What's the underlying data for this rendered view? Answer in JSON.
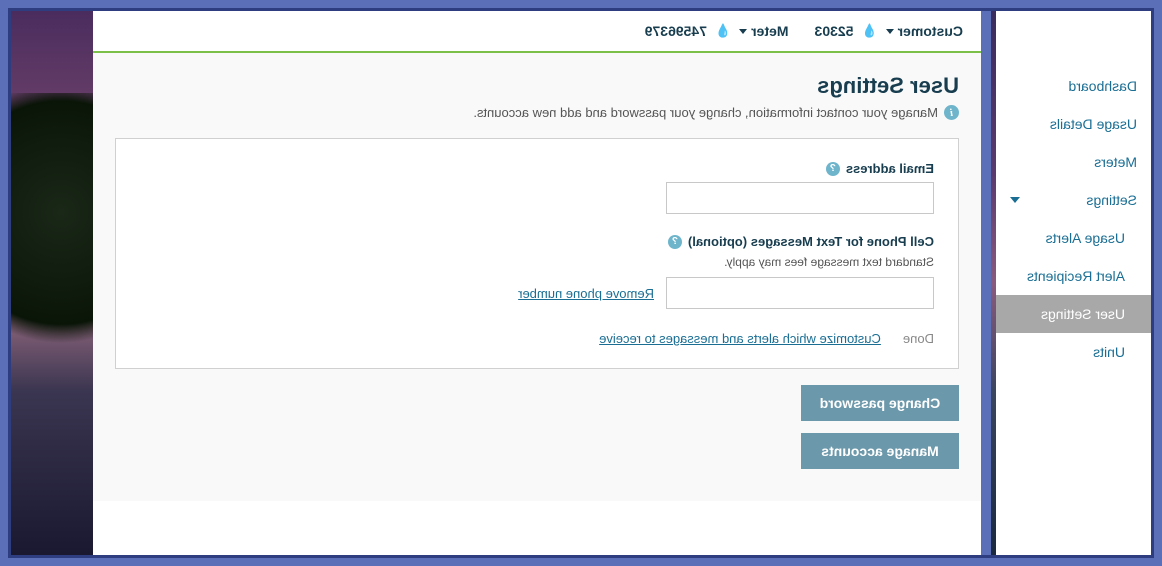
{
  "sidebar": {
    "items": [
      {
        "label": "Dashboard"
      },
      {
        "label": "Usage Details"
      },
      {
        "label": "Meters"
      },
      {
        "label": "Settings"
      },
      {
        "label": "Usage Alerts"
      },
      {
        "label": "Alert Recipients"
      },
      {
        "label": "User Settings"
      },
      {
        "label": "Units"
      }
    ]
  },
  "breadcrumb": {
    "customer_label": "Customer",
    "customer_value": "52303",
    "meter_label": "Meter",
    "meter_value": "74596379"
  },
  "page": {
    "title": "User Settings",
    "subtitle": "Manage your contact information, change your password and add new accounts."
  },
  "form": {
    "email_label": "Email address",
    "email_value": "",
    "phone_label": "Cell Phone for Text Messages (optional)",
    "phone_note": "Standard text message fees may apply.",
    "phone_value": "",
    "remove_phone": "Remove phone number",
    "done": "Done",
    "customize": "Customize which alerts and messages to receive"
  },
  "actions": {
    "change_password": "Change password",
    "manage_accounts": "Manage accounts"
  }
}
